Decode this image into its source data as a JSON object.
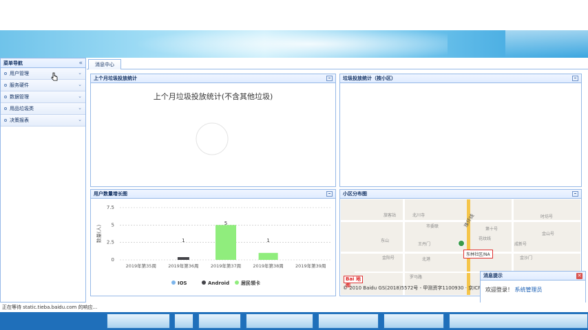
{
  "sidebar": {
    "title": "菜单导航",
    "collapse_icon": "double-chevron-left-icon",
    "items": [
      {
        "label": "用户管理"
      },
      {
        "label": "服务硬件"
      },
      {
        "label": "数据管理"
      },
      {
        "label": "用品垃圾类"
      },
      {
        "label": "决策报表"
      }
    ]
  },
  "tabs": [
    {
      "label": "消息中心"
    }
  ],
  "panels": {
    "monthly": {
      "title": "上个月垃圾投放统计",
      "chart_title": "上个月垃圾投放统计(不含其他垃圾)"
    },
    "community": {
      "title": "垃圾投放统计（按小区）"
    },
    "growth": {
      "title": "用户数量增长图"
    },
    "map": {
      "title": "小区分布图"
    }
  },
  "chart_data": [
    {
      "type": "pie",
      "title": "上个月垃圾投放统计(不含其他垃圾)",
      "values": []
    },
    {
      "type": "bar",
      "title": "",
      "ylabel": "数量(人)",
      "categories": [
        "2019年第35周",
        "2019年第36周",
        "2019年第37周",
        "2019年第38周",
        "2019年第39周"
      ],
      "ylim": [
        0,
        7.5
      ],
      "yticks": [
        "0",
        "2.5",
        "5",
        "7.5"
      ],
      "series": [
        {
          "name": "IOS",
          "color": "#7cb5ec",
          "values": [
            0,
            0,
            0,
            0,
            0
          ]
        },
        {
          "name": "Android",
          "color": "#434348",
          "values": [
            0,
            1,
            0,
            0,
            0
          ]
        },
        {
          "name": "居民领卡",
          "color": "#90ed7d",
          "values": [
            0,
            0,
            5,
            1,
            0
          ]
        }
      ],
      "data_labels": [
        {
          "index": 1,
          "text": "1"
        },
        {
          "index": 2,
          "text": "5"
        },
        {
          "index": 3,
          "text": "1"
        }
      ],
      "grid": "dashed-horizontal",
      "legend_position": "bottom"
    }
  ],
  "map": {
    "labels": [
      "旅客站",
      "北川寺",
      "市委联",
      "第十号",
      "时坊号",
      "东山",
      "王丹门",
      "花纹线",
      "成新号",
      "金山号",
      "金阳号",
      "北港",
      "罗马路",
      "金沙门"
    ],
    "road_label": "珠环线",
    "marker_label": "东林社区/NA",
    "copyright": "© 2010 Baidu    GS(2018)5572号 - 甲测资字1100930 · 京ICP",
    "logo": "Bai 地图"
  },
  "notice": {
    "title": "消息提示",
    "welcome": "欢迎登录！",
    "role": "系统管理员"
  },
  "status": {
    "text": "正在等待 static.tieba.baidu.com 的响应..."
  }
}
